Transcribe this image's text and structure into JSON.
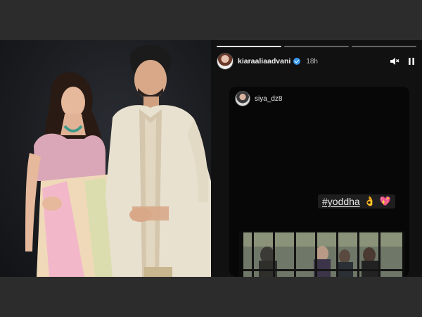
{
  "story": {
    "username": "kiaraaliaadvani",
    "time": "18h",
    "progress": {
      "segments": 3,
      "active_index": 0
    },
    "controls": {
      "mute_icon": "speaker-muted-icon",
      "pause_icon": "pause-icon"
    },
    "reshare": {
      "username": "siya_dz8",
      "hashtag": "#yoddha",
      "emojis": [
        "👌",
        "💖"
      ]
    }
  },
  "colors": {
    "background_band": "#2c2c2c",
    "story_bg": "#111111",
    "verified_badge": "#3897f0",
    "sherwani": "#e9e1d0",
    "saree_pink": "#f2b4cc"
  }
}
